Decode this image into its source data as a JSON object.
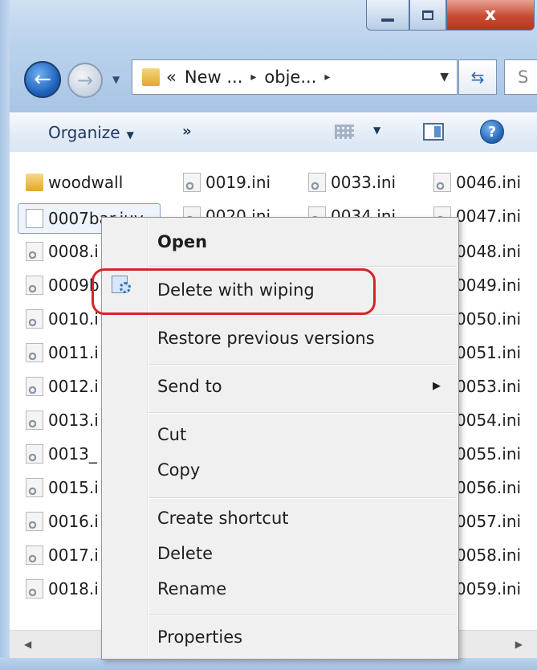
{
  "window": {
    "caption_buttons": {
      "minimize": "minimize",
      "maximize": "maximize",
      "close_label": "x"
    }
  },
  "nav": {
    "address": {
      "overflow": "«",
      "crumb1": "New ...",
      "crumb2": "obje...",
      "separator": "▸"
    },
    "search_placeholder": "S"
  },
  "toolbar": {
    "organize_label": "Organize",
    "more_label": "»",
    "help_label": "?"
  },
  "files": {
    "col1": [
      "woodwall",
      "0007bar.juv",
      "0008.i",
      "0009b",
      "0010.i",
      "0011.i",
      "0012.i",
      "0013.i",
      "0013_",
      "0015.i",
      "0016.i",
      "0017.i",
      "0018.i"
    ],
    "col2": [
      "0019.ini",
      "0020.ini"
    ],
    "col3": [
      "0033.ini",
      "0034.ini"
    ],
    "col4": [
      "0046.ini",
      "0047.ini",
      "0048.ini",
      "0049.ini",
      "0050.ini",
      "0051.ini",
      "0053.ini",
      "0054.ini",
      "0055.ini",
      "0056.ini",
      "0057.ini",
      "0058.ini",
      "0059.ini"
    ]
  },
  "context_menu": {
    "open": "Open",
    "delete_wiping": "Delete with wiping",
    "restore": "Restore previous versions",
    "send_to": "Send to",
    "cut": "Cut",
    "copy": "Copy",
    "create_shortcut": "Create shortcut",
    "delete": "Delete",
    "rename": "Rename",
    "properties": "Properties"
  },
  "colors": {
    "highlight_ring": "#d8232a",
    "close_button": "#c94a33",
    "accent": "#1d5fb8"
  }
}
